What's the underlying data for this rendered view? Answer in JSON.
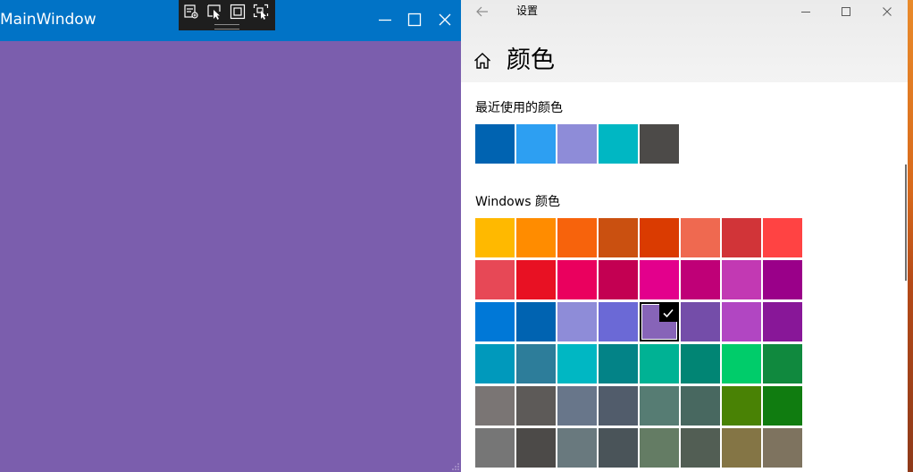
{
  "main_window": {
    "title": "MainWindow",
    "background": "#7b5ead",
    "titlebar_color": "#0173c6",
    "controls": [
      "minimize-icon",
      "maximize-icon",
      "close-icon"
    ],
    "dev_toolbar_tools": [
      "live-visual-tree-icon",
      "select-element-icon",
      "display-layout-adorners-icon",
      "track-focus-icon"
    ]
  },
  "settings": {
    "app_title": "设置",
    "page_title": "颜色",
    "recent_label": "最近使用的颜色",
    "windows_label": "Windows 颜色",
    "recent_colors": [
      "#0063b1",
      "#2d9ff2",
      "#8e8cd8",
      "#00b7c3",
      "#4c4a48"
    ],
    "windows_colors": [
      [
        "#ffb900",
        "#ff8c00",
        "#f7630c",
        "#ca5010",
        "#da3b01",
        "#ef6950",
        "#d13438",
        "#ff4343"
      ],
      [
        "#e74856",
        "#e81123",
        "#ea005e",
        "#c30052",
        "#e3008c",
        "#bf0077",
        "#c239b3",
        "#9a0089"
      ],
      [
        "#0078d7",
        "#0063b1",
        "#8e8cd8",
        "#6b69d6",
        "#8764b8",
        "#744da9",
        "#b146c2",
        "#881798"
      ],
      [
        "#0099bc",
        "#2d7d9a",
        "#00b7c3",
        "#038387",
        "#00b294",
        "#018574",
        "#00cc6a",
        "#10893e"
      ],
      [
        "#7a7574",
        "#5d5a58",
        "#68768a",
        "#515c6b",
        "#567c73",
        "#486860",
        "#498205",
        "#107c10"
      ],
      [
        "#767676",
        "#4c4a48",
        "#69797e",
        "#4a5459",
        "#647c64",
        "#525e54",
        "#847545",
        "#7e735f"
      ]
    ],
    "selected_color": "#8764b8"
  }
}
